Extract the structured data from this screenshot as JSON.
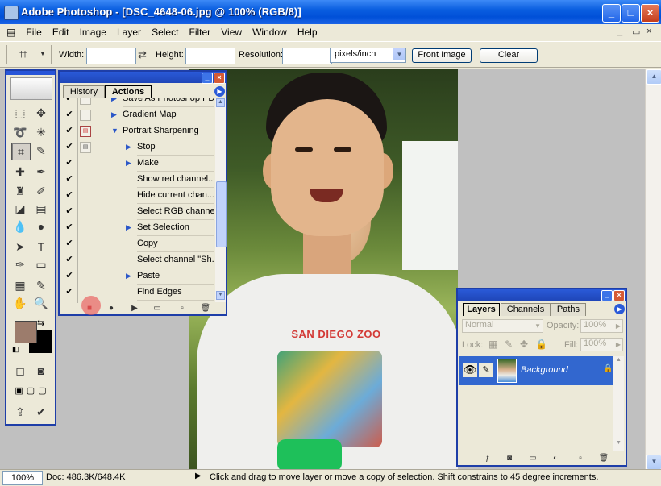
{
  "app": {
    "title": "Adobe Photoshop - [DSC_4648-06.jpg @ 100% (RGB/8)]",
    "window_controls": [
      "_",
      "□",
      "×"
    ]
  },
  "menu": {
    "items": [
      "File",
      "Edit",
      "Image",
      "Layer",
      "Select",
      "Filter",
      "View",
      "Window",
      "Help"
    ],
    "doc_controls": [
      "_",
      "▭",
      "×"
    ]
  },
  "options": {
    "width_label": "Width:",
    "width_value": "",
    "height_label": "Height:",
    "height_value": "",
    "resolution_label": "Resolution:",
    "resolution_value": "",
    "units_select": "pixels/inch",
    "front_image_button": "Front Image",
    "clear_button": "Clear"
  },
  "actions_palette": {
    "tabs": [
      "History",
      "Actions"
    ],
    "active_tab": "Actions",
    "rows": [
      {
        "label": "Save As Photoshop PDF",
        "indent": 1,
        "dialog": "none",
        "expand": "right"
      },
      {
        "label": "Gradient Map",
        "indent": 1,
        "dialog": "none",
        "expand": "right"
      },
      {
        "label": "Portrait Sharpening",
        "indent": 1,
        "dialog": "red",
        "expand": "down"
      },
      {
        "label": "Stop",
        "indent": 2,
        "dialog": "normal",
        "expand": "right"
      },
      {
        "label": "Make",
        "indent": 2,
        "dialog": "none",
        "expand": "right"
      },
      {
        "label": "Show red channel...",
        "indent": 2,
        "dialog": "none",
        "expand": ""
      },
      {
        "label": "Hide current chan...",
        "indent": 2,
        "dialog": "none",
        "expand": ""
      },
      {
        "label": "Select RGB channel",
        "indent": 2,
        "dialog": "none",
        "expand": ""
      },
      {
        "label": "Set Selection",
        "indent": 2,
        "dialog": "none",
        "expand": "right"
      },
      {
        "label": "Copy",
        "indent": 2,
        "dialog": "none",
        "expand": ""
      },
      {
        "label": "Select channel \"Sh...",
        "indent": 2,
        "dialog": "none",
        "expand": ""
      },
      {
        "label": "Paste",
        "indent": 2,
        "dialog": "none",
        "expand": "right"
      },
      {
        "label": "Find Edges",
        "indent": 2,
        "dialog": "none",
        "expand": ""
      }
    ]
  },
  "layers_palette": {
    "tabs": [
      "Layers",
      "Channels",
      "Paths"
    ],
    "active_tab": "Layers",
    "blend_mode": "Normal",
    "opacity_label": "Opacity:",
    "opacity_value": "100%",
    "lock_label": "Lock:",
    "fill_label": "Fill:",
    "fill_value": "100%",
    "layer_name": "Background"
  },
  "photo": {
    "shirt_text": "SAN DIEGO ZOO"
  },
  "status": {
    "zoom": "100%",
    "doc": "Doc: 486.3K/648.4K",
    "message": "Click and drag to move layer or move a copy of selection. Shift constrains to 45 degree increments."
  },
  "colors": {
    "foreground": "#9c7c6c",
    "background": "#000000",
    "title_blue": "#0a5ee0",
    "selection_blue": "#3267cf"
  }
}
